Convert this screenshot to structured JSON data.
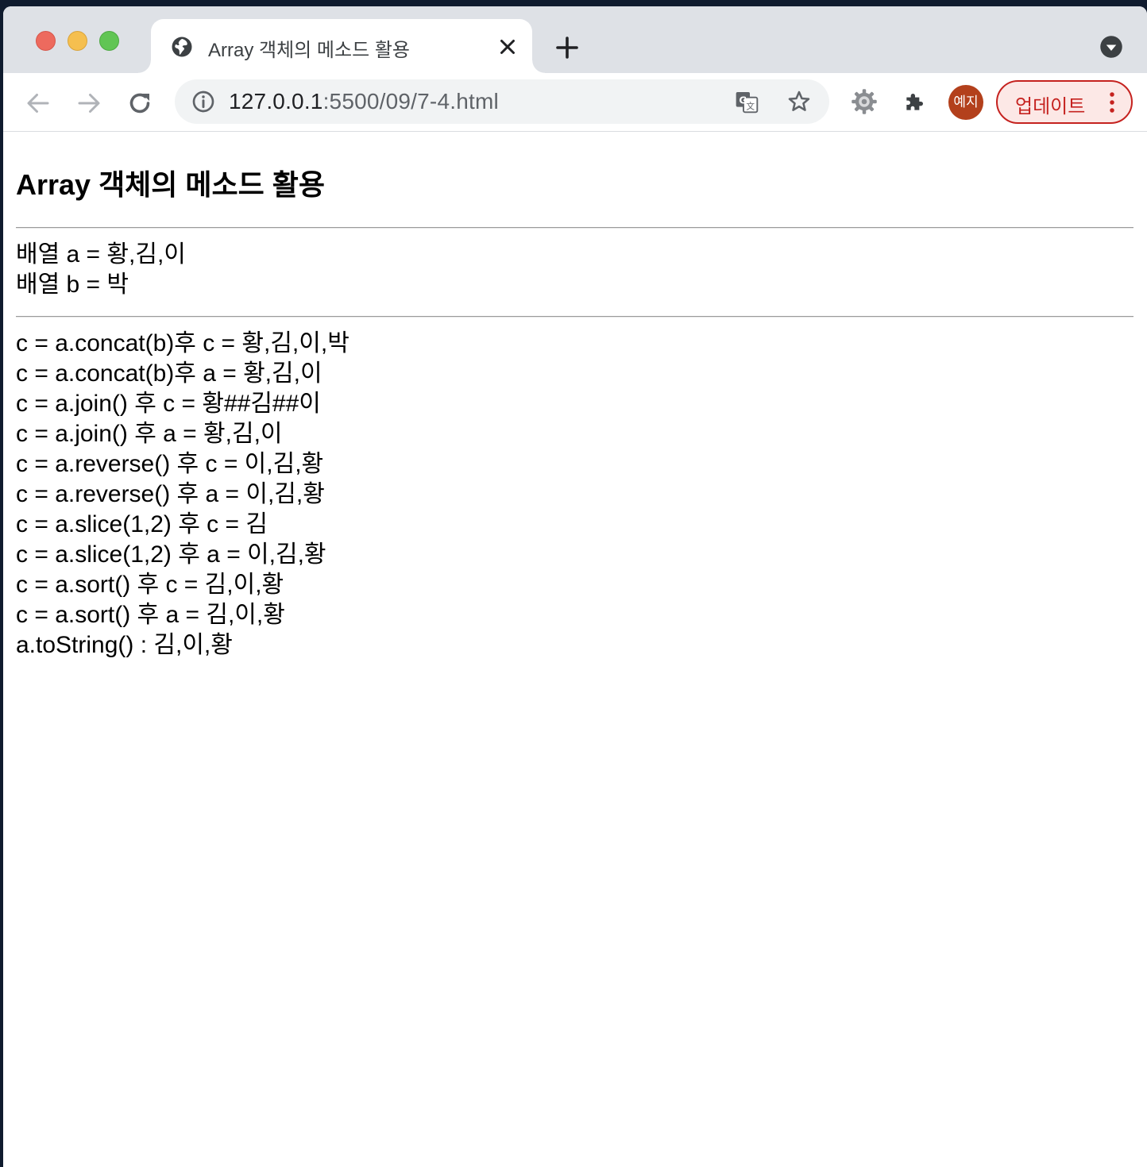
{
  "browser": {
    "tab_title": "Array 객체의 메소드 활용",
    "url_host": "127.0.0.1",
    "url_rest": ":5500/09/7-4.html",
    "profile_label": "예지",
    "update_label": "업데이트",
    "accent_color": "#c5221f"
  },
  "page": {
    "title": "Array 객체의 메소드 활용",
    "arrays": [
      "배열 a = 황,김,이",
      "배열 b = 박"
    ],
    "results": [
      "c = a.concat(b)후 c = 황,김,이,박",
      "c = a.concat(b)후 a = 황,김,이",
      "c = a.join() 후 c = 황##김##이",
      "c = a.join() 후 a = 황,김,이",
      "c = a.reverse() 후 c = 이,김,황",
      "c = a.reverse() 후 a = 이,김,황",
      "c = a.slice(1,2) 후 c = 김",
      "c = a.slice(1,2) 후 a = 이,김,황",
      "c = a.sort() 후 c = 김,이,황",
      "c = a.sort() 후 a = 김,이,황",
      "a.toString() : 김,이,황"
    ]
  }
}
